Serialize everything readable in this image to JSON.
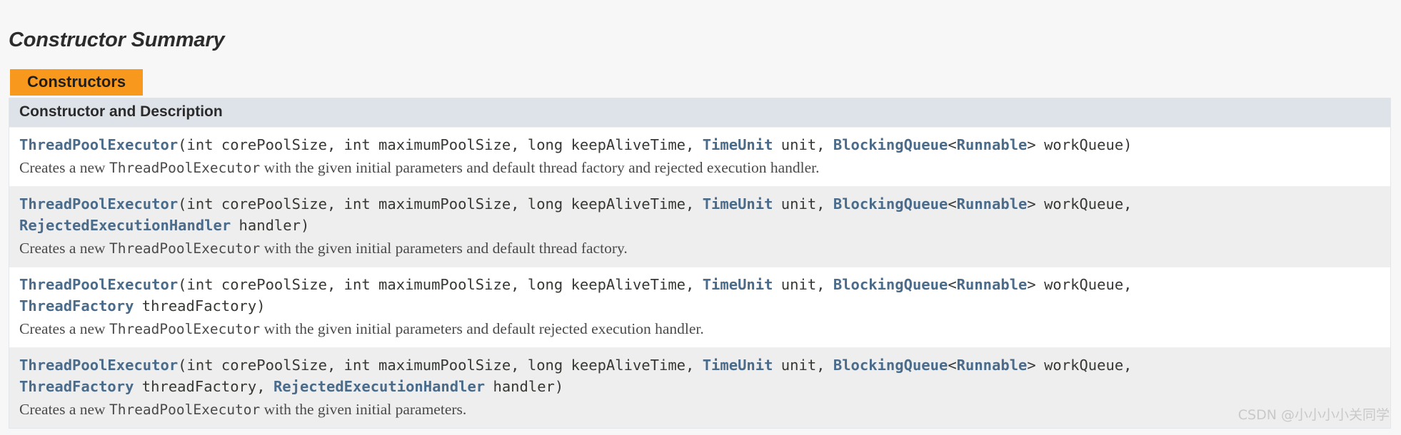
{
  "section": {
    "title": "Constructor Summary",
    "caption_tab": "Constructors",
    "accent_color": "#f8981d",
    "header_bg": "#dee3e9",
    "link_color": "#4a6b8a"
  },
  "table": {
    "column_header": "Constructor and Description",
    "rows": [
      {
        "signature_lines": [
          [
            {
              "text": "ThreadPoolExecutor",
              "kind": "link"
            },
            {
              "text": "(int corePoolSize, int maximumPoolSize, long keepAliveTime, ",
              "kind": "plain"
            },
            {
              "text": "TimeUnit",
              "kind": "link"
            },
            {
              "text": " unit, ",
              "kind": "plain"
            },
            {
              "text": "BlockingQueue",
              "kind": "link"
            },
            {
              "text": "<",
              "kind": "plain"
            },
            {
              "text": "Runnable",
              "kind": "link"
            },
            {
              "text": "> workQueue)",
              "kind": "plain"
            }
          ]
        ],
        "description_parts": [
          {
            "text": "Creates a new ",
            "kind": "prose"
          },
          {
            "text": "ThreadPoolExecutor",
            "kind": "code"
          },
          {
            "text": " with the given initial parameters and default thread factory and rejected execution handler.",
            "kind": "prose"
          }
        ]
      },
      {
        "signature_lines": [
          [
            {
              "text": "ThreadPoolExecutor",
              "kind": "link"
            },
            {
              "text": "(int corePoolSize, int maximumPoolSize, long keepAliveTime, ",
              "kind": "plain"
            },
            {
              "text": "TimeUnit",
              "kind": "link"
            },
            {
              "text": " unit, ",
              "kind": "plain"
            },
            {
              "text": "BlockingQueue",
              "kind": "link"
            },
            {
              "text": "<",
              "kind": "plain"
            },
            {
              "text": "Runnable",
              "kind": "link"
            },
            {
              "text": "> workQueue,",
              "kind": "plain"
            }
          ],
          [
            {
              "text": "RejectedExecutionHandler",
              "kind": "link"
            },
            {
              "text": " handler)",
              "kind": "plain"
            }
          ]
        ],
        "description_parts": [
          {
            "text": "Creates a new ",
            "kind": "prose"
          },
          {
            "text": "ThreadPoolExecutor",
            "kind": "code"
          },
          {
            "text": " with the given initial parameters and default thread factory.",
            "kind": "prose"
          }
        ]
      },
      {
        "signature_lines": [
          [
            {
              "text": "ThreadPoolExecutor",
              "kind": "link"
            },
            {
              "text": "(int corePoolSize, int maximumPoolSize, long keepAliveTime, ",
              "kind": "plain"
            },
            {
              "text": "TimeUnit",
              "kind": "link"
            },
            {
              "text": " unit, ",
              "kind": "plain"
            },
            {
              "text": "BlockingQueue",
              "kind": "link"
            },
            {
              "text": "<",
              "kind": "plain"
            },
            {
              "text": "Runnable",
              "kind": "link"
            },
            {
              "text": "> workQueue,",
              "kind": "plain"
            }
          ],
          [
            {
              "text": "ThreadFactory",
              "kind": "link"
            },
            {
              "text": " threadFactory)",
              "kind": "plain"
            }
          ]
        ],
        "description_parts": [
          {
            "text": "Creates a new ",
            "kind": "prose"
          },
          {
            "text": "ThreadPoolExecutor",
            "kind": "code"
          },
          {
            "text": " with the given initial parameters and default rejected execution handler.",
            "kind": "prose"
          }
        ]
      },
      {
        "signature_lines": [
          [
            {
              "text": "ThreadPoolExecutor",
              "kind": "link"
            },
            {
              "text": "(int corePoolSize, int maximumPoolSize, long keepAliveTime, ",
              "kind": "plain"
            },
            {
              "text": "TimeUnit",
              "kind": "link"
            },
            {
              "text": " unit, ",
              "kind": "plain"
            },
            {
              "text": "BlockingQueue",
              "kind": "link"
            },
            {
              "text": "<",
              "kind": "plain"
            },
            {
              "text": "Runnable",
              "kind": "link"
            },
            {
              "text": "> workQueue,",
              "kind": "plain"
            }
          ],
          [
            {
              "text": "ThreadFactory",
              "kind": "link"
            },
            {
              "text": " threadFactory, ",
              "kind": "plain"
            },
            {
              "text": "RejectedExecutionHandler",
              "kind": "link"
            },
            {
              "text": " handler)",
              "kind": "plain"
            }
          ]
        ],
        "description_parts": [
          {
            "text": "Creates a new ",
            "kind": "prose"
          },
          {
            "text": "ThreadPoolExecutor",
            "kind": "code"
          },
          {
            "text": " with the given initial parameters.",
            "kind": "prose"
          }
        ]
      }
    ]
  },
  "watermark": {
    "text": "CSDN @小小小小关同学"
  }
}
